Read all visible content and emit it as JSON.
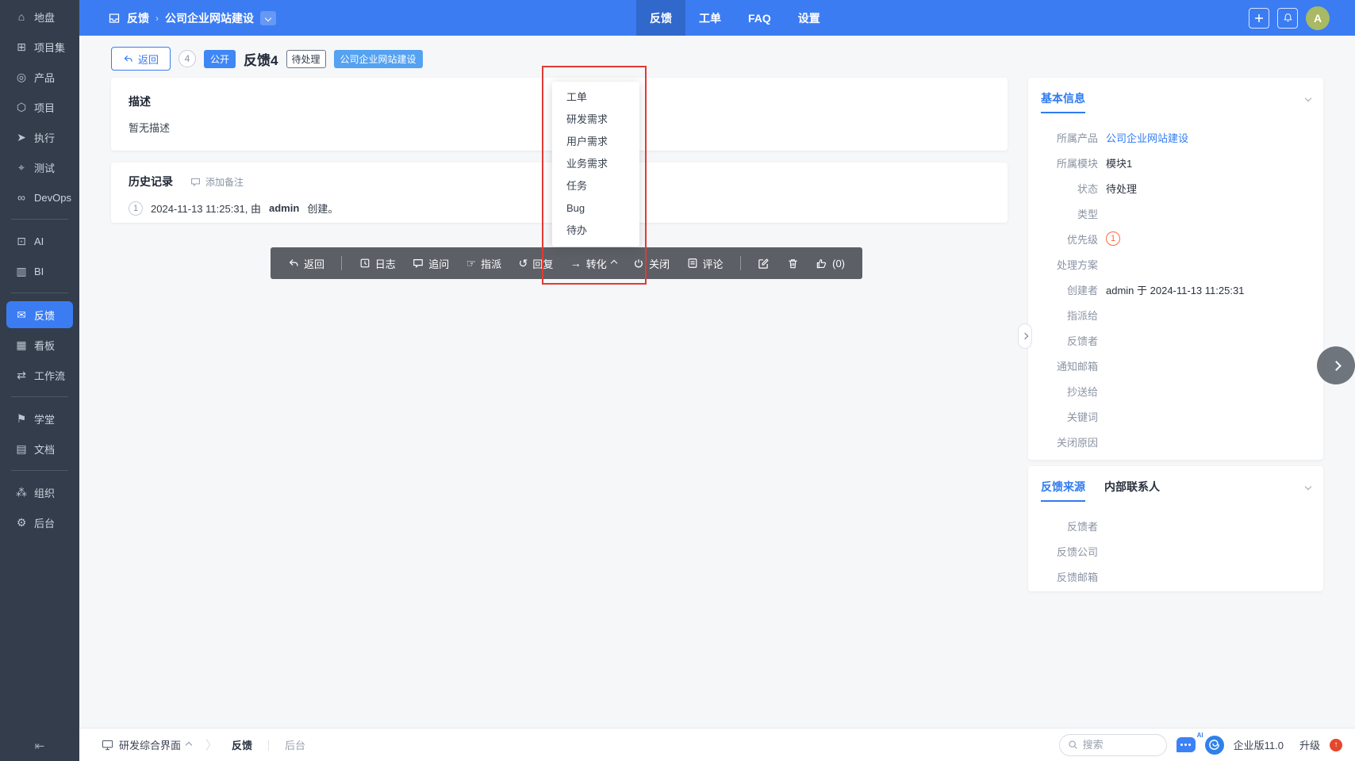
{
  "sidebar": {
    "items": [
      {
        "name": "home",
        "icon": "⌂",
        "label": "地盘"
      },
      {
        "name": "program",
        "icon": "⊞",
        "label": "项目集"
      },
      {
        "name": "product",
        "icon": "◎",
        "label": "产品"
      },
      {
        "name": "project",
        "icon": "⬡",
        "label": "项目"
      },
      {
        "name": "execution",
        "icon": "➤",
        "label": "执行"
      },
      {
        "name": "qa",
        "icon": "⌖",
        "label": "测试"
      },
      {
        "name": "devops",
        "icon": "∞",
        "label": "DevOps"
      },
      {
        "name": "ai",
        "icon": "⊡",
        "label": "AI"
      },
      {
        "name": "bi",
        "icon": "▥",
        "label": "BI"
      },
      {
        "name": "feedback",
        "icon": "✉",
        "label": "反馈"
      },
      {
        "name": "kanban",
        "icon": "▦",
        "label": "看板"
      },
      {
        "name": "workflow",
        "icon": "⇄",
        "label": "工作流"
      },
      {
        "name": "tutorial",
        "icon": "⚑",
        "label": "学堂"
      },
      {
        "name": "doc",
        "icon": "▤",
        "label": "文档"
      },
      {
        "name": "org",
        "icon": "⁂",
        "label": "组织"
      },
      {
        "name": "admin",
        "icon": "⚙",
        "label": "后台"
      }
    ]
  },
  "topbar": {
    "breadcrumb": {
      "module": "反馈",
      "sep": "›",
      "item": "公司企业网站建设"
    },
    "tabs": [
      {
        "label": "反馈"
      },
      {
        "label": "工单"
      },
      {
        "label": "FAQ"
      },
      {
        "label": "设置"
      }
    ],
    "avatar": "A"
  },
  "title_bar": {
    "back": "返回",
    "id": "4",
    "visibility": "公开",
    "title": "反馈4",
    "status": "待处理",
    "product": "公司企业网站建设"
  },
  "description": {
    "heading": "描述",
    "body": "暂无描述"
  },
  "history": {
    "heading": "历史记录",
    "add_note": "添加备注",
    "entry": {
      "index": "1",
      "time": "2024-11-13 11:25:31, 由",
      "user": "admin",
      "action": "创建。"
    }
  },
  "toolbar": {
    "back": "返回",
    "log": "日志",
    "ask": "追问",
    "assign": "指派",
    "reply": "回复",
    "convert": "转化",
    "close": "关闭",
    "comment": "评论",
    "likes": "(0)"
  },
  "convert_menu": {
    "items": [
      {
        "label": "工单"
      },
      {
        "label": "研发需求"
      },
      {
        "label": "用户需求"
      },
      {
        "label": "业务需求"
      },
      {
        "label": "任务"
      },
      {
        "label": "Bug"
      },
      {
        "label": "待办"
      }
    ]
  },
  "basic_info": {
    "heading": "基本信息",
    "fields": [
      {
        "label": "所属产品",
        "value": "公司企业网站建设"
      },
      {
        "label": "所属模块",
        "value": "模块1"
      },
      {
        "label": "状态",
        "value": "待处理"
      },
      {
        "label": "类型",
        "value": ""
      },
      {
        "label": "优先级",
        "value": "1"
      },
      {
        "label": "处理方案",
        "value": ""
      },
      {
        "label": "创建者",
        "value": "admin 于 2024-11-13 11:25:31"
      },
      {
        "label": "指派给",
        "value": ""
      },
      {
        "label": "反馈者",
        "value": ""
      },
      {
        "label": "通知邮箱",
        "value": ""
      },
      {
        "label": "抄送给",
        "value": ""
      },
      {
        "label": "关键词",
        "value": ""
      },
      {
        "label": "关闭原因",
        "value": ""
      }
    ]
  },
  "feedback_source": {
    "tabs": [
      {
        "label": "反馈来源"
      },
      {
        "label": "内部联系人"
      }
    ],
    "fields": [
      {
        "label": "反馈者"
      },
      {
        "label": "反馈公司"
      },
      {
        "label": "反馈邮箱"
      }
    ]
  },
  "footer": {
    "view": "研发综合界面",
    "nav_feedback": "反馈",
    "nav_admin": "后台",
    "search_placeholder": "搜索",
    "edition": "企业版11.0",
    "upgrade": "升级"
  },
  "colors": {
    "primary": "#3b7cf2",
    "sidebar": "#333d4c",
    "annotation": "#e23a35",
    "priority": "#ff6a3d",
    "product_badge": "#55a1f2"
  }
}
